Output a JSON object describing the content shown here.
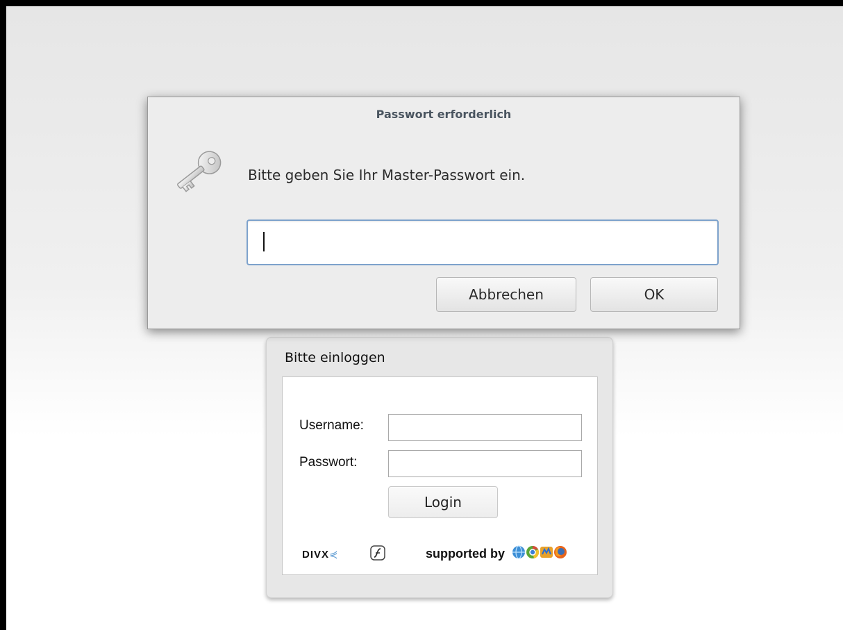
{
  "dialog": {
    "title": "Passwort erforderlich",
    "message": "Bitte geben Sie Ihr Master-Passwort ein.",
    "password_value": "",
    "cancel_label": "Abbrechen",
    "ok_label": "OK",
    "icon": "key-icon",
    "focus_color": "#7da2cc"
  },
  "login": {
    "title": "Bitte einloggen",
    "username_label": "Username:",
    "username_value": "",
    "password_label": "Passwort:",
    "password_value": "",
    "login_label": "Login",
    "divx_logo_text": "DIVX",
    "supported_text": "supported by",
    "plugin_icons": [
      "divx-logo",
      "flash-icon"
    ],
    "browser_icons": [
      "browser-globe-icon",
      "chrome-icon",
      "winamp-icon",
      "firefox-icon"
    ]
  }
}
